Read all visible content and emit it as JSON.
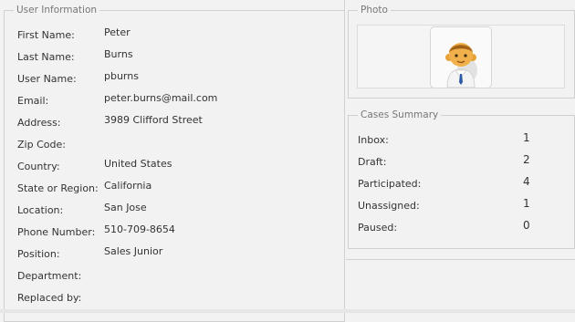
{
  "user_info": {
    "legend": "User Information",
    "fields": [
      {
        "label": "First Name:",
        "value": "Peter"
      },
      {
        "label": "Last Name:",
        "value": "Burns"
      },
      {
        "label": "User Name:",
        "value": "pburns"
      },
      {
        "label": "Email:",
        "value": "peter.burns@mail.com"
      },
      {
        "label": "Address:",
        "value": "3989 Clifford Street"
      },
      {
        "label": "Zip Code:",
        "value": ""
      },
      {
        "label": "Country:",
        "value": "United States"
      },
      {
        "label": "State or Region:",
        "value": "California"
      },
      {
        "label": "Location:",
        "value": "San Jose"
      },
      {
        "label": "Phone Number:",
        "value": "510-709-8654"
      },
      {
        "label": "Position:",
        "value": "Sales Junior"
      },
      {
        "label": "Department:",
        "value": ""
      },
      {
        "label": "Replaced by:",
        "value": ""
      }
    ]
  },
  "photo": {
    "legend": "Photo",
    "icon": "user-avatar-icon"
  },
  "cases_summary": {
    "legend": "Cases Summary",
    "items": [
      {
        "label": "Inbox:",
        "count": "1"
      },
      {
        "label": "Draft:",
        "count": "2"
      },
      {
        "label": "Participated:",
        "count": "4"
      },
      {
        "label": "Unassigned:",
        "count": "1"
      },
      {
        "label": "Paused:",
        "count": "0"
      }
    ]
  },
  "colors": {
    "background": "#f2f2f2",
    "border": "#d0d0d0",
    "legend_text": "#777777",
    "text": "#333333"
  }
}
